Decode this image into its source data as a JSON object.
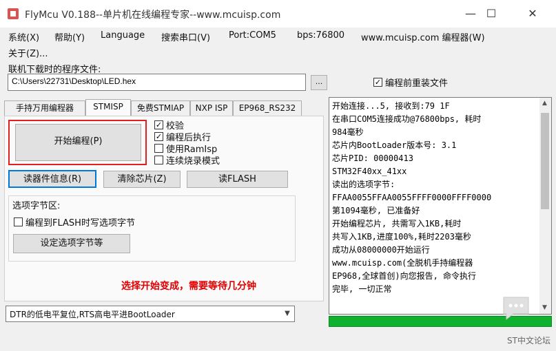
{
  "window": {
    "title": "FlyMcu V0.188--单片机在线编程专家--www.mcuisp.com",
    "min": "—",
    "max": "☐",
    "close": "✕"
  },
  "menu": {
    "items": [
      "系统(X)",
      "帮助(Y)",
      "Language",
      "搜索串口(V)",
      "Port:COM5",
      "bps:76800",
      "www.mcuisp.com 编程器(W)"
    ],
    "about": "关于(Z)..."
  },
  "file": {
    "label": "联机下载时的程序文件:",
    "path": "C:\\Users\\22731\\Desktop\\LED.hex",
    "browse": "...",
    "reload_label": "编程前重装文件",
    "reload_checked": true
  },
  "tabs": [
    "手持万用编程器",
    "STMISP",
    "免费STMIAP",
    "NXP ISP",
    "EP968_RS232"
  ],
  "active_tab": "STMISP",
  "actions": {
    "start": "开始编程(P)",
    "read_info": "读器件信息(R)",
    "erase": "清除芯片(Z)",
    "read_flash": "读FLASH"
  },
  "options": [
    {
      "label": "校验",
      "checked": true
    },
    {
      "label": "编程后执行",
      "checked": true
    },
    {
      "label": "使用RamIsp",
      "checked": false
    },
    {
      "label": "连续烧录模式",
      "checked": false
    }
  ],
  "option_bytes": {
    "title": "选项字节区:",
    "write_label": "编程到FLASH时写选项字节",
    "write_checked": false,
    "set_button": "设定选项字节等"
  },
  "hint": "选择开始变成，需要等待几分钟",
  "reset_mode": "DTR的低电平复位,RTS高电平进BootLoader",
  "log": [
    "开始连接...5, 接收到:79 1F",
    "在串口COM5连接成功@76800bps, 耗时",
    "984毫秒",
    "芯片内BootLoader版本号: 3.1",
    "芯片PID: 00000413",
    "STM32F40xx_41xx",
    "读出的选项字节:",
    "FFAA0055FFAA0055FFFF0000FFFF0000",
    "第1094毫秒, 已准备好",
    "开始编程芯片, 共需写入1KB,耗时",
    "共写入1KB,进度100%,耗时2203毫秒",
    "成功从08000000开始运行",
    "www.mcuisp.com(全脱机手持编程器",
    "EP968,全球首创)向您报告, 命令执行",
    "完毕, 一切正常"
  ],
  "progress": 100,
  "watermark": "ST中文论坛"
}
